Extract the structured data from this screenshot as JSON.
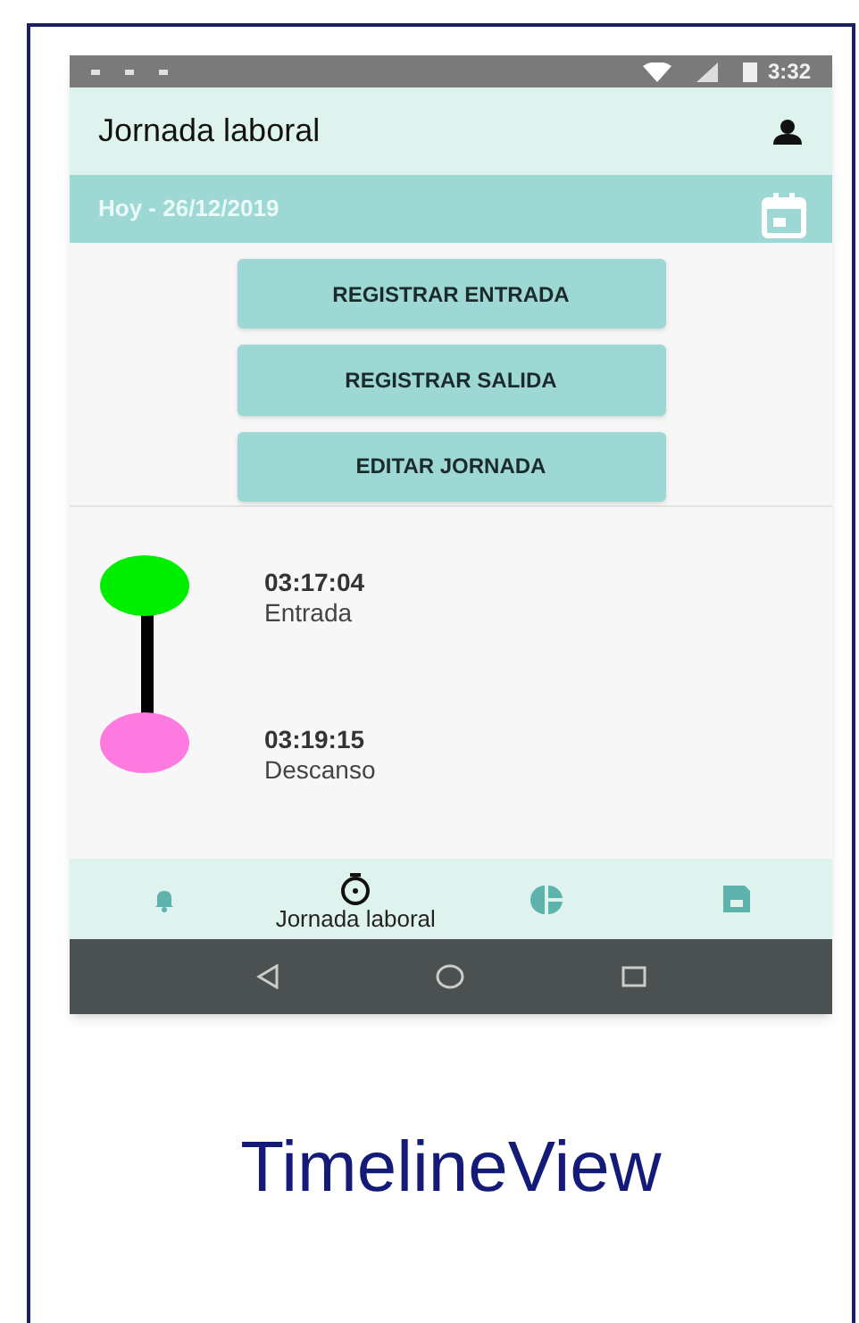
{
  "status_bar": {
    "time": "3:32"
  },
  "toolbar": {
    "title": "Jornada laboral"
  },
  "date_bar": {
    "text": "Hoy - 26/12/2019"
  },
  "buttons": [
    "REGISTRAR ENTRADA",
    "REGISTRAR SALIDA",
    "EDITAR JORNADA"
  ],
  "timeline": [
    {
      "time": "03:17:04",
      "label": "Entrada",
      "color": "#00ee00"
    },
    {
      "time": "03:19:15",
      "label": "Descanso",
      "color": "#ff7ae0"
    }
  ],
  "bottom_nav": [
    {
      "selected": false
    },
    {
      "selected": true,
      "label": "Jornada laboral"
    },
    {
      "selected": false
    },
    {
      "selected": false
    }
  ],
  "caption": "TimelineView"
}
